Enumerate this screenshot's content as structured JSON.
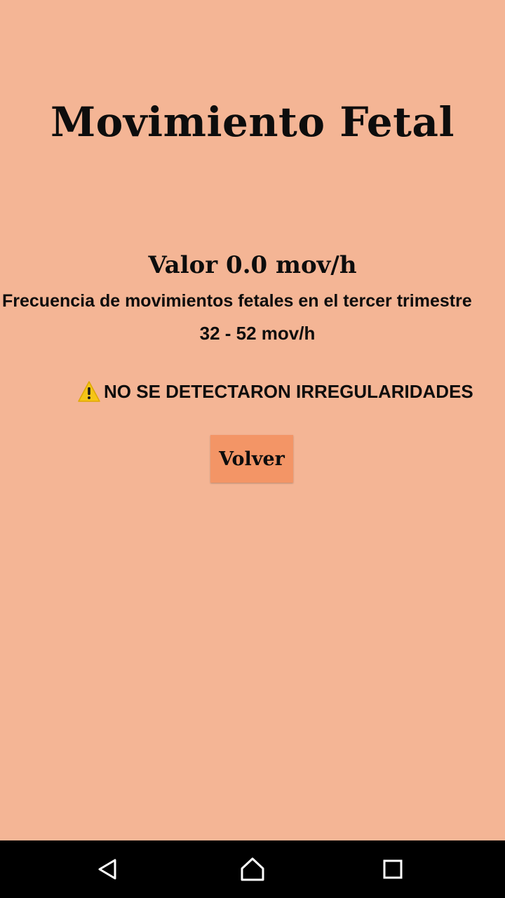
{
  "screen": {
    "title": "Movimiento Fetal",
    "value_line": "Valor 0.0 mov/h",
    "frequency_label": "Frecuencia de movimientos fetales en el tercer trimestre",
    "range": "32 - 52 mov/h",
    "status_icon": "warning-icon",
    "status_text": "NO SE DETECTARON IRREGULARIDADES",
    "back_button_label": "Volver"
  },
  "colors": {
    "background": "#f4b595",
    "button": "#f39566",
    "warning": "#f5c518",
    "navbar": "#000000"
  },
  "navbar": {
    "items": [
      "back-icon",
      "home-icon",
      "recents-icon"
    ]
  }
}
